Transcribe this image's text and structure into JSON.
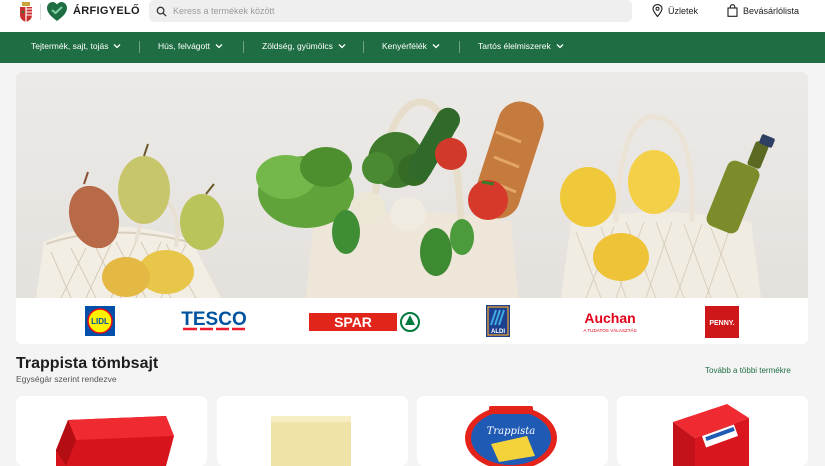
{
  "header": {
    "brand_name": "ÁRFIGYELŐ",
    "search_placeholder": "Keress a termékek között",
    "stores_label": "Üzletek",
    "shopping_list_label": "Bevásárlólista",
    "brand_color": "#1f6e43"
  },
  "nav": {
    "items": [
      {
        "label": "Tejtermék, sajt, tojás"
      },
      {
        "label": "Hús, felvágott"
      },
      {
        "label": "Zöldség, gyümölcs"
      },
      {
        "label": "Kenyérfélék"
      },
      {
        "label": "Tartós élelmiszerek"
      }
    ]
  },
  "stores": {
    "lidl": "LIDL",
    "tesco": "TESCO",
    "spar": "SPAR",
    "aldi": "ALDI",
    "auchan": "Auchan",
    "auchan_tagline": "A TUDATOS VÁLASZTÁS",
    "penny": "PENNY."
  },
  "section": {
    "title": "Trappista tömbsajt",
    "subtitle": "Egységár szerint rendezve",
    "more_link": "Tovább a többi termékre"
  },
  "products": {
    "card3_label": "Trappista"
  }
}
